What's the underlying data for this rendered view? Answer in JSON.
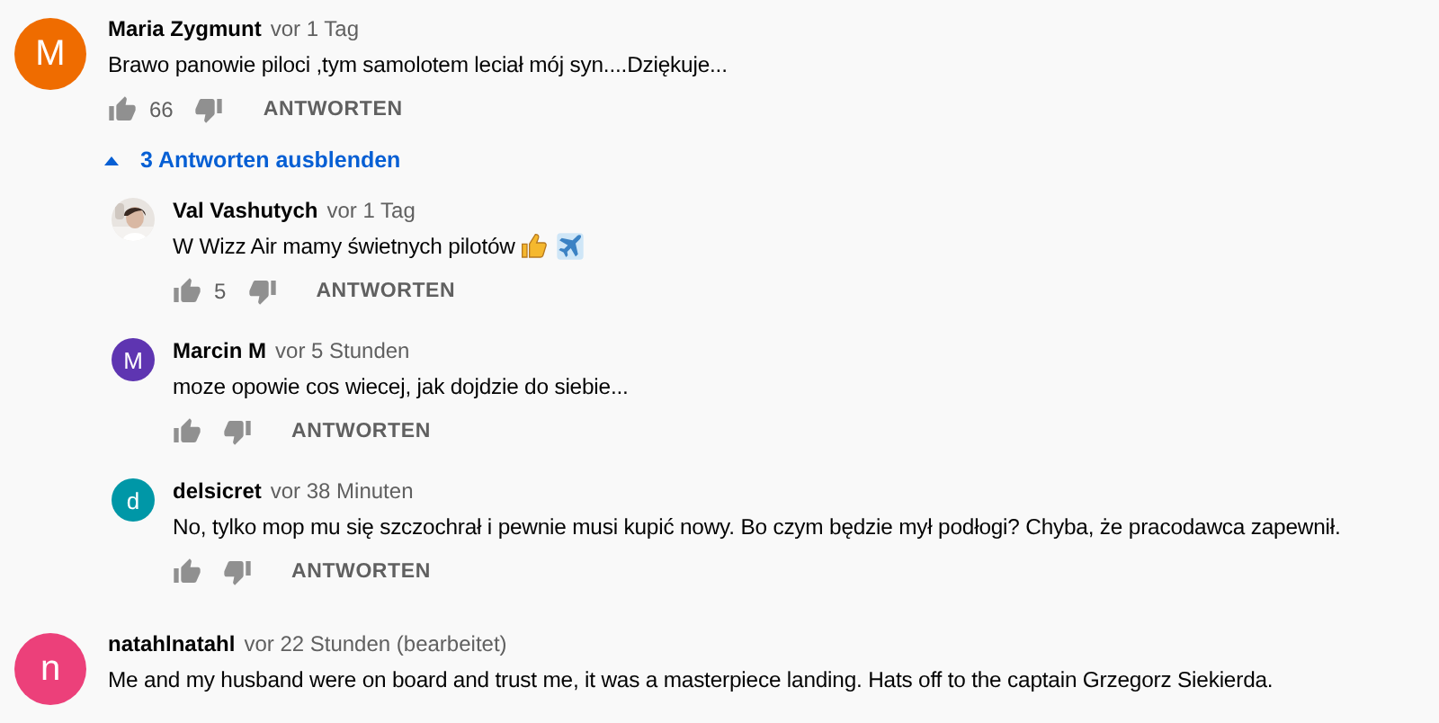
{
  "comments": [
    {
      "author": "Maria Zygmunt",
      "time": "vor 1 Tag",
      "avatar": {
        "kind": "letter",
        "letter": "M",
        "color": "#ef6c00"
      },
      "text": "Brawo panowie piloci ,tym samolotem leciał mój syn....Dziękuje...",
      "likes": "66",
      "reply_label": "ANTWORTEN",
      "replies_toggle": {
        "label": "3 Antworten ausblenden",
        "expanded": true
      },
      "replies": [
        {
          "author": "Val Vashutych",
          "time": "vor 1 Tag",
          "text": "W Wizz Air mamy świetnych pilotów",
          "likes": "5",
          "reply_label": "ANTWORTEN"
        },
        {
          "author": "Marcin M",
          "time": "vor 5 Stunden",
          "avatar": {
            "kind": "letter",
            "letter": "M",
            "color": "#5e35b1"
          },
          "text": "moze opowie cos wiecej, jak dojdzie do siebie...",
          "reply_label": "ANTWORTEN"
        },
        {
          "author": "delsicret",
          "time": "vor 38 Minuten",
          "avatar": {
            "kind": "letter",
            "letter": "d",
            "color": "#0097a7"
          },
          "text": "No, tylko mop mu się szczochrał i pewnie musi kupić nowy. Bo czym będzie mył podłogi? Chyba, że pracodawca zapewnił.",
          "reply_label": "ANTWORTEN"
        }
      ]
    },
    {
      "author": "natahlnatahl",
      "time": "vor 22 Stunden (bearbeitet)",
      "avatar": {
        "kind": "letter",
        "letter": "n",
        "color": "#ec407a"
      },
      "text": "Me and my husband were on board and trust me, it was a masterpiece landing. Hats off to the captain Grzegorz Siekierda."
    }
  ]
}
